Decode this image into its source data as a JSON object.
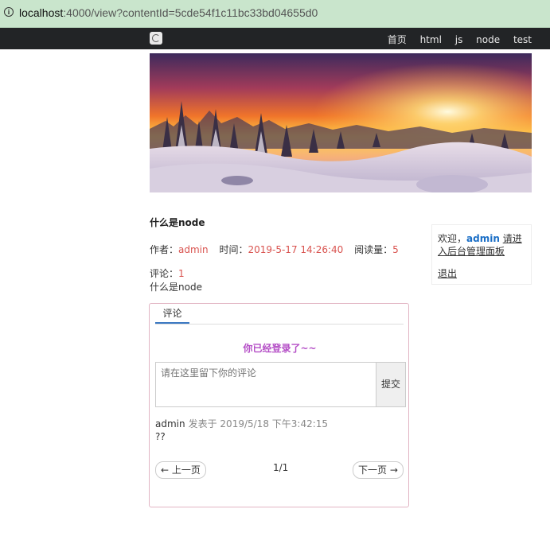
{
  "browser": {
    "url_host": "localhost",
    "url_path": ":4000/view?contentId=5cde54f1c11bc33bd04655d0"
  },
  "nav": {
    "items": [
      "首页",
      "html",
      "js",
      "node",
      "test"
    ]
  },
  "article": {
    "title": "什么是node",
    "author_label": "作者：",
    "author": "admin",
    "time_label": "时间：",
    "time": "2019-5-17 14:26:40",
    "views_label": "阅读量：",
    "views": "5",
    "comments_label": "评论：",
    "comments": "1",
    "content": "什么是node"
  },
  "sidebar": {
    "welcome": "欢迎，",
    "user": "admin",
    "admin_link": "请进入后台管理面板",
    "logout": "退出"
  },
  "comments": {
    "tab": "评论",
    "logged_in": "你已经登录了~~",
    "placeholder": "请在这里留下你的评论",
    "submit": "提交",
    "items": [
      {
        "user": "admin",
        "time": "发表于 2019/5/18 下午3:42:15",
        "text": "??"
      }
    ],
    "prev": "← 上一页",
    "page": "1/1",
    "next": "下一页 →"
  },
  "colors": {
    "accent": "#d9534f",
    "link": "#1a6ec6",
    "logged": "#b44ec6",
    "navbar": "#222426"
  }
}
